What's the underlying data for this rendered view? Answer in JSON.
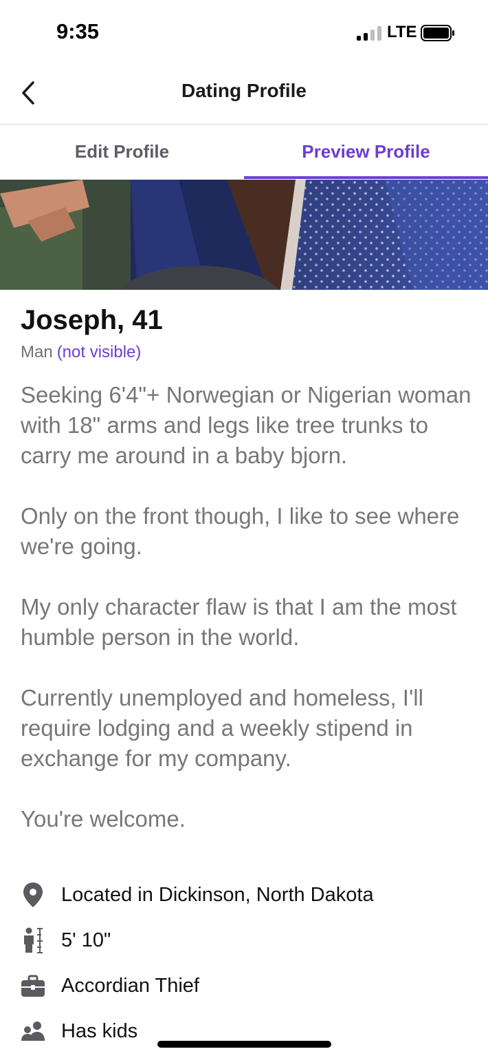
{
  "status_bar": {
    "time": "9:35",
    "network": "LTE"
  },
  "nav": {
    "title": "Dating Profile"
  },
  "tabs": [
    {
      "label": "Edit Profile",
      "active": false
    },
    {
      "label": "Preview Profile",
      "active": true
    }
  ],
  "profile": {
    "name_age": "Joseph, 41",
    "gender": "Man",
    "gender_visibility": "(not visible)",
    "bio": [
      "Seeking 6'4\"+ Norwegian or Nigerian woman with 18\" arms and legs like tree trunks to carry me around in a baby bjorn.",
      "Only on the front though, I like to see where we're going.",
      "My only character flaw is that I am the most humble person in the world.",
      "Currently unemployed and homeless, I'll require lodging and a weekly stipend in exchange for my company.",
      "You're welcome."
    ],
    "details": [
      {
        "icon": "location-pin-icon",
        "text": "Located in Dickinson, North Dakota"
      },
      {
        "icon": "height-icon",
        "text": "5' 10\""
      },
      {
        "icon": "briefcase-icon",
        "text": "Accordian Thief"
      },
      {
        "icon": "people-icon",
        "text": "Has kids"
      }
    ]
  },
  "colors": {
    "accent": "#6b3fd1",
    "body_text": "#76767c",
    "detail_icon": "#5a5a60"
  }
}
